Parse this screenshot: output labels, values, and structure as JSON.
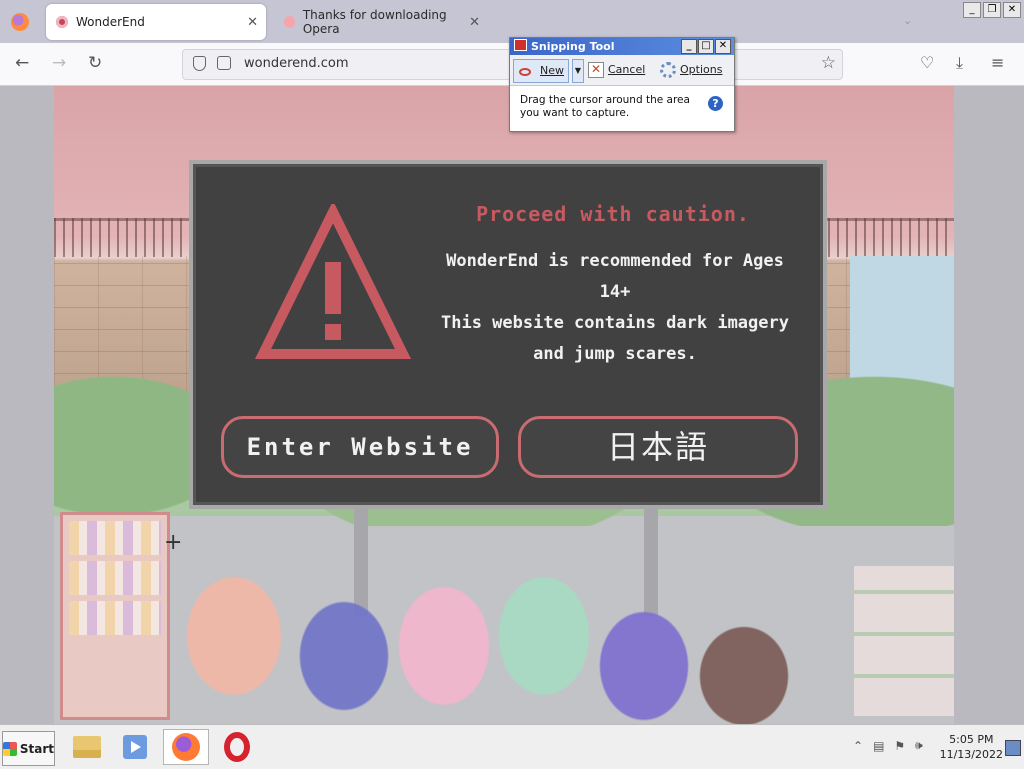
{
  "browser": {
    "tabs": [
      {
        "title": "WonderEnd",
        "active": true
      },
      {
        "title": "Thanks for downloading Opera",
        "active": false
      }
    ],
    "url": "wonderend.com",
    "icons": [
      "back-icon",
      "forward-icon",
      "reload-icon",
      "shield-icon",
      "lock-icon",
      "bookmark-star-icon",
      "pocket-icon",
      "download-icon",
      "menu-icon"
    ]
  },
  "modal": {
    "title": "Proceed with caution.",
    "message_line1": "WonderEnd is recommended for Ages",
    "message_line2": "14+",
    "message_line3": "This website contains dark imagery",
    "message_line4": "and jump scares.",
    "enter_label": "Enter Website",
    "japanese_label": "日本語",
    "accent_color": "#c75a60"
  },
  "snipping_tool": {
    "title": "Snipping Tool",
    "new_label": "New",
    "cancel_label": "Cancel",
    "options_label": "Options",
    "message": "Drag the cursor around the area you want to capture."
  },
  "taskbar": {
    "start_label": "Start",
    "time": "5:05 PM",
    "date": "11/13/2022",
    "apps": [
      "file-explorer",
      "media-player",
      "firefox",
      "opera"
    ]
  }
}
